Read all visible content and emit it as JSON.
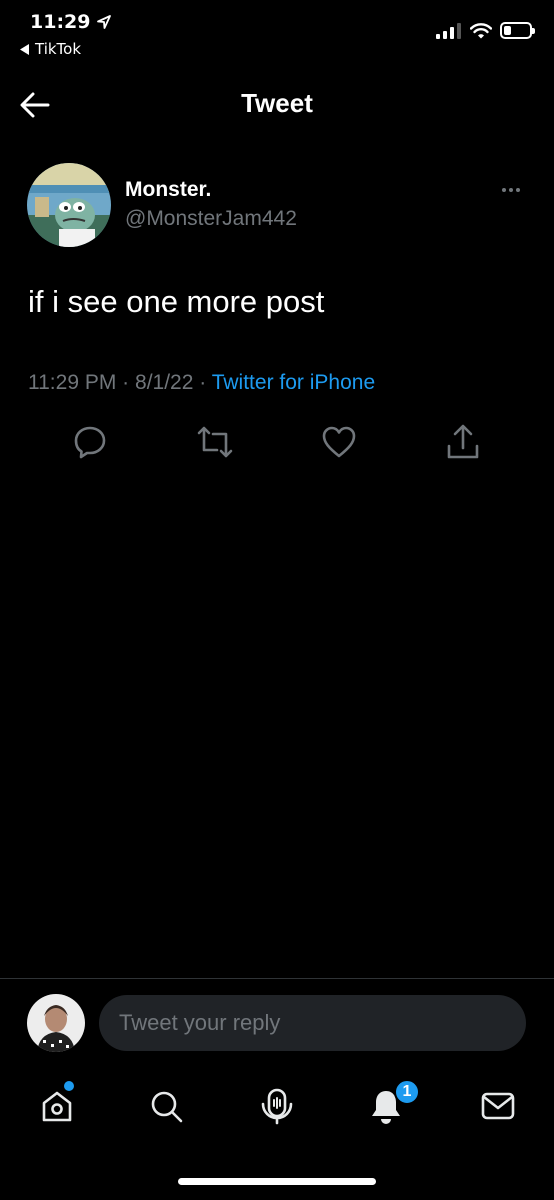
{
  "status_bar": {
    "time": "11:29",
    "back_app": "TikTok",
    "battery_level": 0.3
  },
  "header": {
    "title": "Tweet"
  },
  "tweet": {
    "author_name": "Monster.",
    "author_handle": "@MonsterJam442",
    "text": "if i see one more post",
    "time": "11:29 PM",
    "separator": "·",
    "date": "8/1/22",
    "source": "Twitter for iPhone"
  },
  "reply": {
    "placeholder": "Tweet your reply"
  },
  "tab_bar": {
    "notifications_badge": "1"
  },
  "colors": {
    "background": "#000000",
    "accent": "#1d9bf0",
    "secondary_text": "#71767b",
    "reply_field": "#202327"
  },
  "icons": [
    "location-arrow-icon",
    "back-triangle-icon",
    "signal-icon",
    "wifi-icon",
    "battery-icon",
    "back-arrow-icon",
    "more-icon",
    "reply-icon",
    "retweet-icon",
    "like-icon",
    "share-icon",
    "home-icon",
    "search-icon",
    "spaces-icon",
    "notifications-icon",
    "messages-icon"
  ]
}
